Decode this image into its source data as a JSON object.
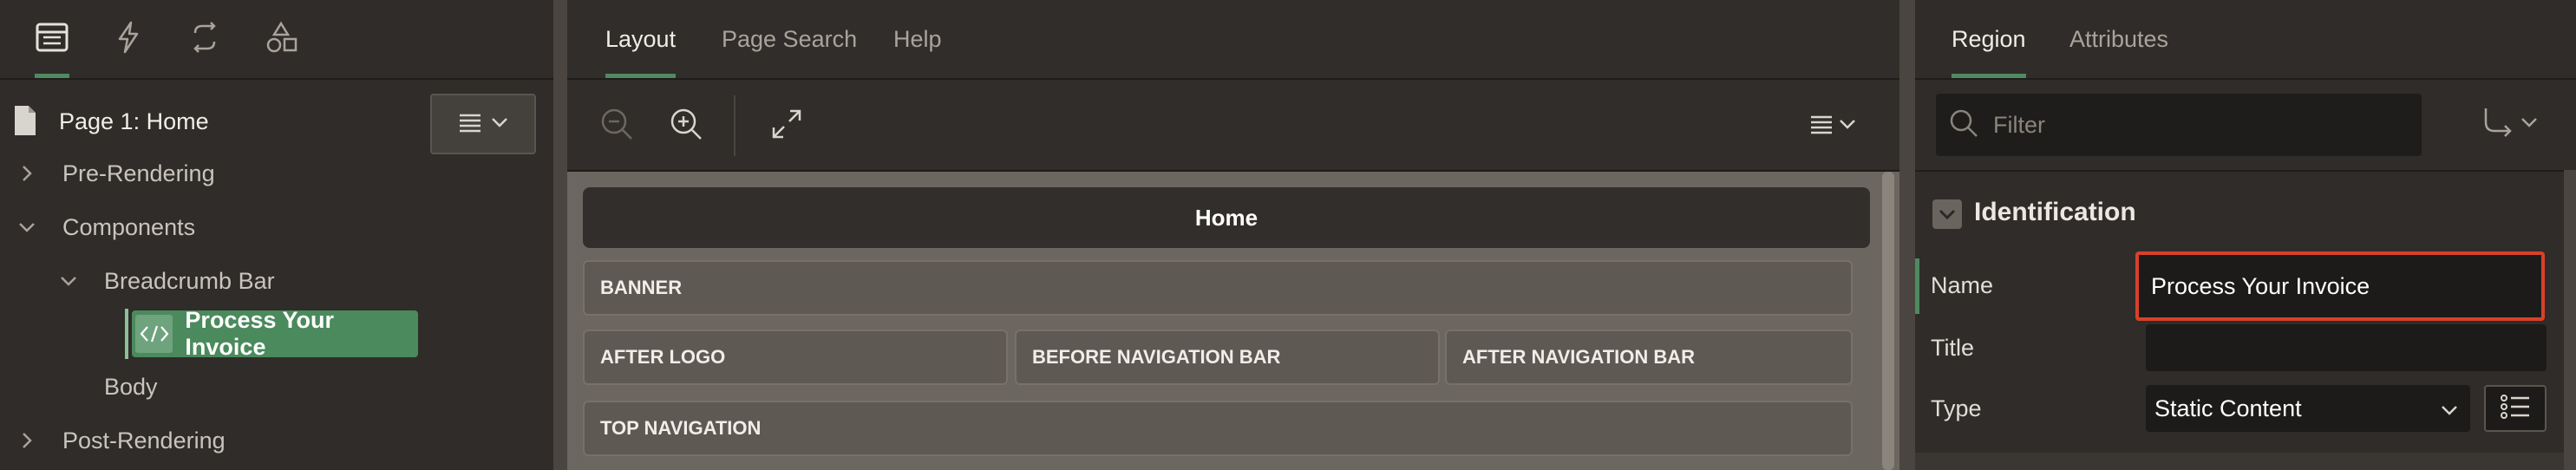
{
  "left": {
    "icon_tabs": [
      {
        "icon": "rendering-tree-icon",
        "active": true
      },
      {
        "icon": "dynamic-actions-icon",
        "active": false
      },
      {
        "icon": "processing-icon",
        "active": false
      },
      {
        "icon": "shared-components-icon",
        "active": false
      }
    ],
    "page_title": "Page 1: Home",
    "tree": {
      "pre_rendering": "Pre-Rendering",
      "components": "Components",
      "breadcrumb_bar": "Breadcrumb Bar",
      "selected": "Process Your Invoice",
      "body": "Body",
      "post_rendering": "Post-Rendering"
    }
  },
  "center": {
    "tabs": {
      "layout": "Layout",
      "page_search": "Page Search",
      "help": "Help"
    },
    "layout": {
      "home": "Home",
      "banner": "BANNER",
      "after_logo": "AFTER LOGO",
      "before_nav": "BEFORE NAVIGATION BAR",
      "after_nav": "AFTER NAVIGATION BAR",
      "top_nav": "TOP NAVIGATION"
    }
  },
  "right": {
    "tabs": {
      "region": "Region",
      "attributes": "Attributes"
    },
    "filter_placeholder": "Filter",
    "section_title": "Identification",
    "labels": {
      "name": "Name",
      "title": "Title",
      "type": "Type"
    },
    "values": {
      "name": "Process Your Invoice",
      "title": "",
      "type": "Static Content"
    }
  },
  "colors": {
    "accent": "#4f8a60",
    "highlight": "#d8412a",
    "selected_node": "#4a8a5c"
  }
}
